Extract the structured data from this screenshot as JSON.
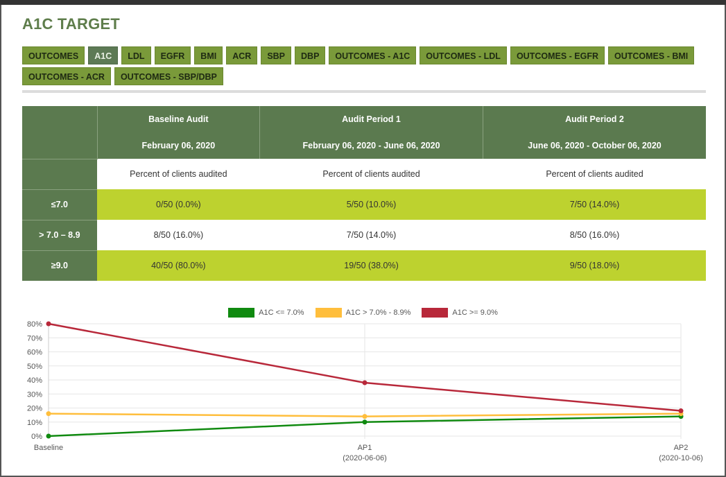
{
  "page": {
    "title": "A1C TARGET"
  },
  "tabs": {
    "row1": [
      "OUTCOMES",
      "A1C",
      "LDL",
      "EGFR",
      "BMI",
      "ACR",
      "SBP",
      "DBP",
      "OUTCOMES - A1C",
      "OUTCOMES - LDL",
      "OUTCOMES - EGFR",
      "OUTCOMES - BMI"
    ],
    "row2": [
      "OUTCOMES - ACR",
      "OUTCOMES - SBP/DBP"
    ],
    "active": "A1C"
  },
  "table": {
    "columns": [
      {
        "title": "Baseline Audit",
        "date": "February 06, 2020",
        "sub": "Percent of clients audited"
      },
      {
        "title": "Audit Period 1",
        "date": "February 06, 2020 - June 06, 2020",
        "sub": "Percent of clients audited"
      },
      {
        "title": "Audit Period 2",
        "date": "June 06, 2020 - October 06, 2020",
        "sub": "Percent of clients audited"
      }
    ],
    "rows": [
      {
        "label": "≤7.0",
        "values": [
          "0/50 (0.0%)",
          "5/50 (10.0%)",
          "7/50 (14.0%)"
        ]
      },
      {
        "label": "> 7.0 – 8.9",
        "values": [
          "8/50 (16.0%)",
          "7/50 (14.0%)",
          "8/50 (16.0%)"
        ]
      },
      {
        "label": "≥9.0",
        "values": [
          "40/50 (80.0%)",
          "19/50 (38.0%)",
          "9/50 (18.0%)"
        ]
      }
    ]
  },
  "chart_data": {
    "type": "line",
    "categories": [
      "Baseline",
      "AP1",
      "AP2"
    ],
    "category_sublabels": [
      "",
      "(2020-06-06)",
      "(2020-10-06)"
    ],
    "ylim": [
      0,
      80
    ],
    "yticks": [
      "0%",
      "10%",
      "20%",
      "30%",
      "40%",
      "50%",
      "60%",
      "70%",
      "80%"
    ],
    "grid": true,
    "legend_position": "top",
    "series": [
      {
        "name": "A1C <= 7.0%",
        "color": "#108a10",
        "values": [
          0,
          10,
          14
        ]
      },
      {
        "name": "A1C > 7.0% - 8.9%",
        "color": "#ffbe3c",
        "values": [
          16,
          14,
          16
        ]
      },
      {
        "name": "A1C >= 9.0%",
        "color": "#b8283a",
        "values": [
          80,
          38,
          18
        ]
      }
    ]
  }
}
